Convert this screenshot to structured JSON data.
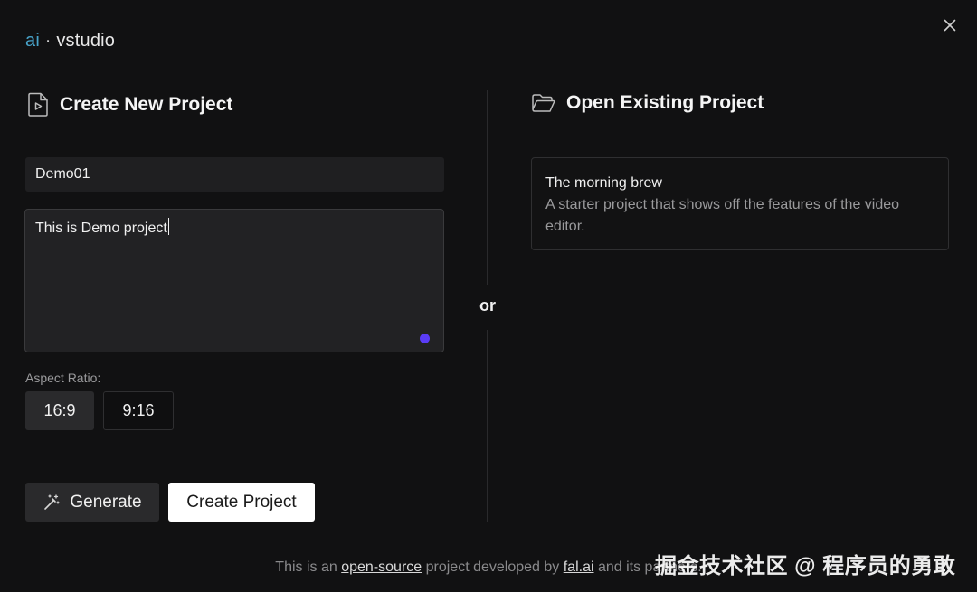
{
  "brand": {
    "prefix": "ai",
    "separator": " · ",
    "name": "vstudio"
  },
  "create": {
    "title": "Create New Project",
    "name_value": "Demo01",
    "description_value": "This is Demo project",
    "aspect_label": "Aspect Ratio:",
    "aspect_options": [
      "16:9",
      "9:16"
    ],
    "aspect_selected": "16:9",
    "generate_label": "Generate",
    "create_label": "Create Project"
  },
  "divider_text": "or",
  "open": {
    "title": "Open Existing Project",
    "projects": [
      {
        "name": "The morning brew",
        "description": "A starter project that shows off the features of the video editor."
      }
    ]
  },
  "footer": {
    "text_before": "This is an ",
    "link1": "open-source",
    "text_middle": " project developed by ",
    "link2": "fal.ai",
    "text_after": " and its partners."
  },
  "watermark": "掘金技术社区 @ 程序员的勇敢",
  "colors": {
    "accent_dot": "#5a3cf6",
    "brand_ai": "#48a3c9",
    "background": "#111112"
  }
}
